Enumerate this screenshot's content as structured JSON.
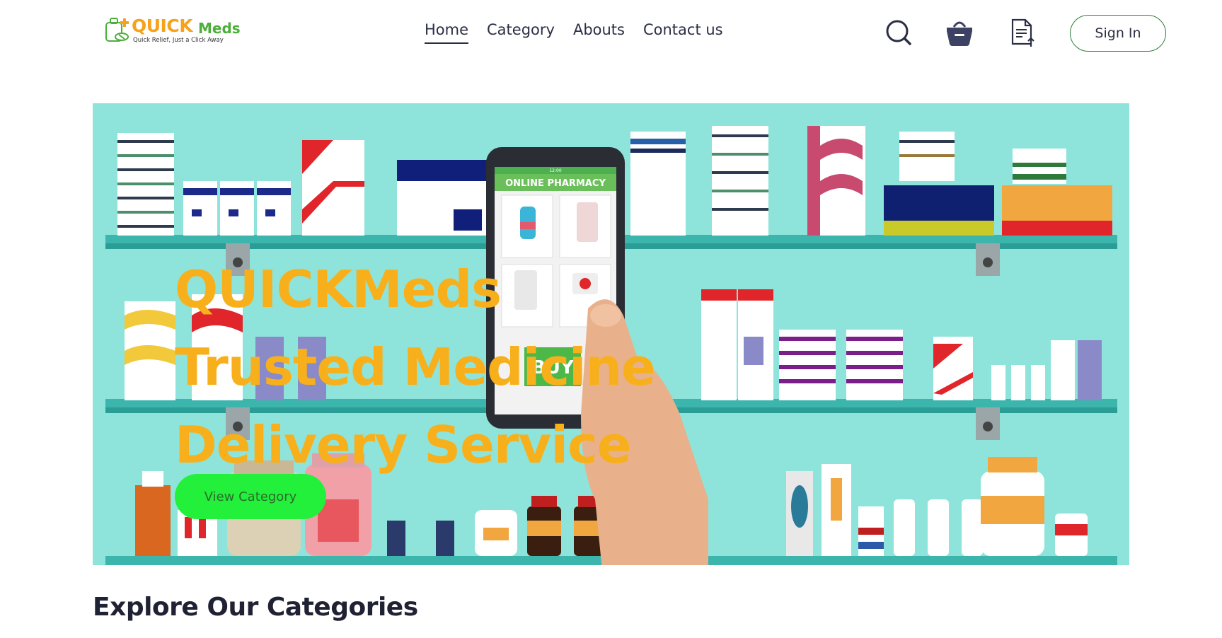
{
  "brand": {
    "name_part1": "QUICK",
    "name_part2": "Meds",
    "tagline": "Quick Relief, Just a Click Away"
  },
  "nav": {
    "items": [
      {
        "label": "Home",
        "active": true
      },
      {
        "label": "Category",
        "active": false
      },
      {
        "label": "Abouts",
        "active": false
      },
      {
        "label": "Contact us",
        "active": false
      }
    ]
  },
  "header_icons": [
    "search-icon",
    "cart-basket-icon",
    "orders-document-icon"
  ],
  "auth": {
    "signin_label": "Sign In"
  },
  "hero": {
    "title_line1": "QUICKMeds",
    "title_line2": "Trusted Medicine",
    "title_line3": "Delivery Service",
    "cta_label": "View Category",
    "phone_header": "ONLINE PHARMACY",
    "phone_buy": "BUY",
    "phone_time": "12:00"
  },
  "sections": {
    "categories_title": "Explore Our Categories"
  },
  "colors": {
    "brand_orange": "#f7a21b",
    "brand_green": "#4cae3b",
    "hero_bg": "#8ee4db",
    "cta_green": "#22f03a",
    "title_yellow": "#f7b01c",
    "nav_text": "#2b2f45"
  }
}
